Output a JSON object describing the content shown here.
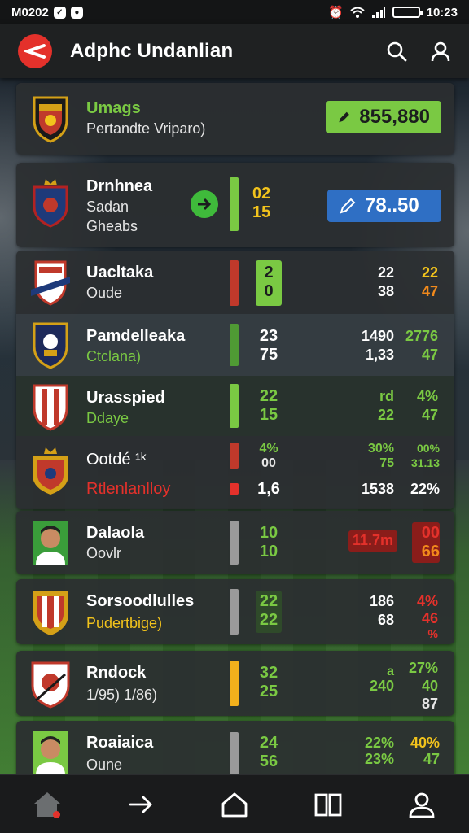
{
  "status_bar": {
    "time_left": "M0202",
    "time_right": "10:23"
  },
  "header": {
    "title": "Adphc Undanlian",
    "search_icon": "search-icon",
    "profile_icon": "user-icon"
  },
  "colors": {
    "green": "#7ac943",
    "red": "#e4312b",
    "yellow": "#f2c31c",
    "blue": "#2f6fc4",
    "orange": "#f28a1c"
  },
  "featured": [
    {
      "name": "Umags",
      "sub": "Pertandte Vriparo)",
      "odds": "855,880",
      "odds_icon": "pencil-icon"
    },
    {
      "name": "Drnhnea",
      "sub": "Sadan",
      "sub2": "Gheabs",
      "score_top": "02",
      "score_bottom": "15",
      "odds": "78..50",
      "odds_icon": "pencil-icon"
    }
  ],
  "matches": [
    {
      "name": "Uacltaka",
      "sub": "Oude",
      "s1": "2",
      "s2": "0",
      "r1a": "22",
      "r1b": "38",
      "r2a": "22",
      "r2b": "47"
    },
    {
      "name": "Pamdelleaka",
      "sub": "Ctclana)",
      "s1": "23",
      "s2": "75",
      "r1a": "1490",
      "r1b": "1,33",
      "r2a": "2776",
      "r2b": "47"
    },
    {
      "name": "Urasspied",
      "sub": "Ddaye",
      "s1": "22",
      "s2": "15",
      "r1a": "rd",
      "r1b": "22",
      "r2a": "4%",
      "r2b": "47"
    },
    {
      "name": "Ootdé ¹ᵏ",
      "sub": "Rtlenlanlloy",
      "s1": "4%",
      "s2": "00",
      "s3": "1,6",
      "r1a": "30%",
      "r1b": "75",
      "r1c": "1538",
      "r2a": "00%",
      "r2b": "31.13",
      "r2c": "22%"
    },
    {
      "name": "Dalaola",
      "sub": "Oovlr",
      "s1": "10",
      "s2": "10",
      "tag": "11.7m",
      "r2a": "00",
      "r2b": "66"
    },
    {
      "name": "Sorsoodlulles",
      "sub": "Pudertbige)",
      "s1": "22",
      "s2": "22",
      "r1a": "186",
      "r1b": "68",
      "r2a": "4%",
      "r2b": "46",
      "r2c": "%"
    },
    {
      "name": "Rndock",
      "sub": "1/95) 1/86)",
      "s1": "32",
      "s2": "25",
      "r1a": "a",
      "r1b": "240",
      "r2a": "27%",
      "r2b": "40",
      "r2c": "87"
    },
    {
      "name": "Roaiaica",
      "sub": "Oune",
      "s1": "24",
      "s2": "56",
      "r1a": "22%",
      "r1b": "23%",
      "r2a": "40%",
      "r2b": "47"
    }
  ],
  "bottom_nav": [
    {
      "name": "home-icon"
    },
    {
      "name": "arrow-icon"
    },
    {
      "name": "house-icon"
    },
    {
      "name": "book-icon"
    },
    {
      "name": "profile-icon"
    }
  ]
}
